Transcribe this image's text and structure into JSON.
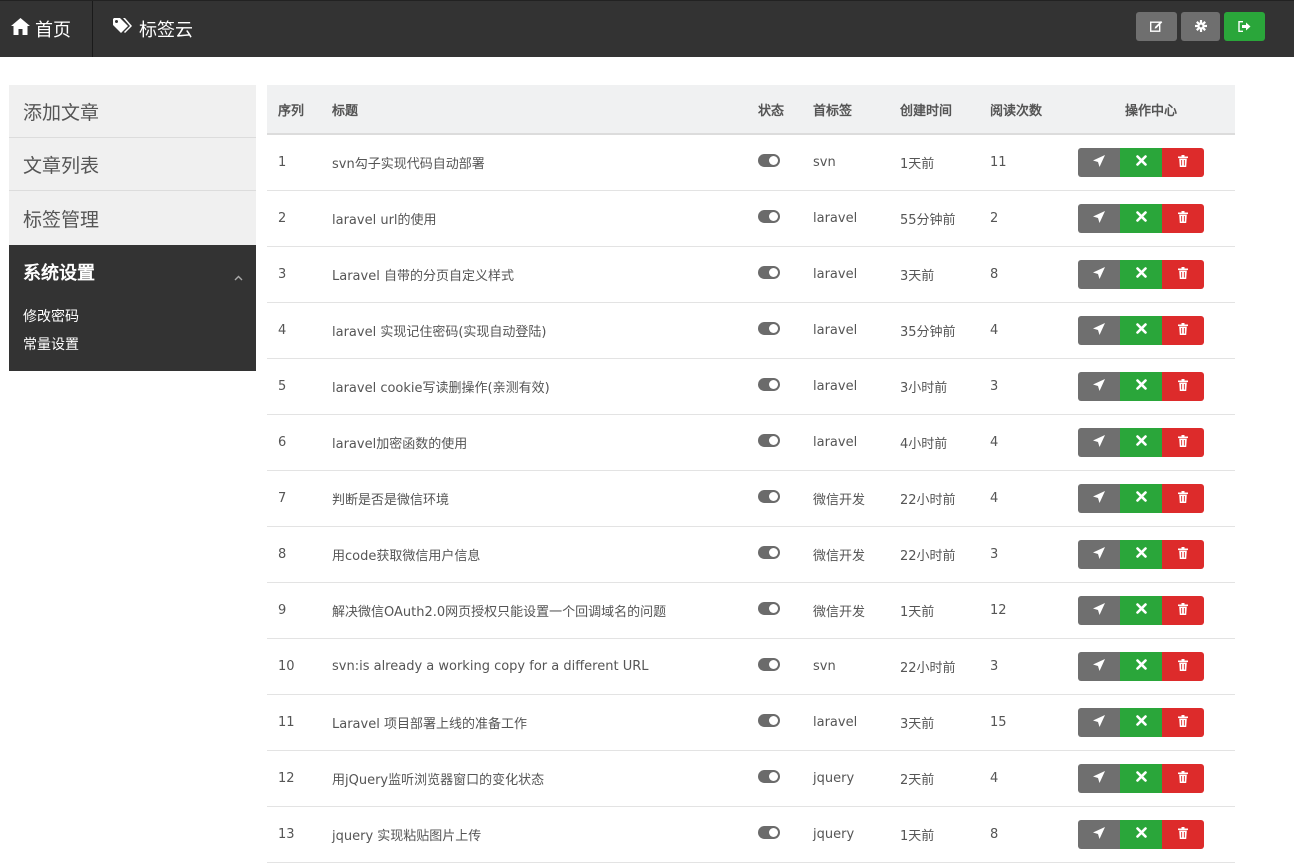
{
  "topbar": {
    "home_label": "首页",
    "tags_label": "标签云",
    "tools": [
      "edit-icon",
      "gear-icon",
      "sign-out-icon"
    ]
  },
  "sidebar": {
    "items": [
      {
        "label": "添加文章"
      },
      {
        "label": "文章列表"
      },
      {
        "label": "标签管理"
      }
    ],
    "group": {
      "label": "系统设置",
      "subitems": [
        {
          "label": "修改密码"
        },
        {
          "label": "常量设置"
        }
      ]
    }
  },
  "table": {
    "headers": {
      "idx": "序列",
      "title": "标题",
      "status": "状态",
      "tag": "首标签",
      "time": "创建时间",
      "views": "阅读次数",
      "ops": "操作中心"
    },
    "rows": [
      {
        "idx": "1",
        "title": "svn勾子实现代码自动部署",
        "tag": "svn",
        "time": "1天前",
        "views": "11"
      },
      {
        "idx": "2",
        "title": "laravel url的使用",
        "tag": "laravel",
        "time": "55分钟前",
        "views": "2"
      },
      {
        "idx": "3",
        "title": "Laravel 自带的分页自定义样式",
        "tag": "laravel",
        "time": "3天前",
        "views": "8"
      },
      {
        "idx": "4",
        "title": "laravel 实现记住密码(实现自动登陆)",
        "tag": "laravel",
        "time": "35分钟前",
        "views": "4"
      },
      {
        "idx": "5",
        "title": "laravel cookie写读删操作(亲测有效)",
        "tag": "laravel",
        "time": "3小时前",
        "views": "3"
      },
      {
        "idx": "6",
        "title": "laravel加密函数的使用",
        "tag": "laravel",
        "time": "4小时前",
        "views": "4"
      },
      {
        "idx": "7",
        "title": "判断是否是微信环境",
        "tag": "微信开发",
        "time": "22小时前",
        "views": "4"
      },
      {
        "idx": "8",
        "title": "用code获取微信用户信息",
        "tag": "微信开发",
        "time": "22小时前",
        "views": "3"
      },
      {
        "idx": "9",
        "title": "解决微信OAuth2.0网页授权只能设置一个回调域名的问题",
        "tag": "微信开发",
        "time": "1天前",
        "views": "12"
      },
      {
        "idx": "10",
        "title": "svn:is already a working copy for a different URL",
        "tag": "svn",
        "time": "22小时前",
        "views": "3"
      },
      {
        "idx": "11",
        "title": "Laravel 项目部署上线的准备工作",
        "tag": "laravel",
        "time": "3天前",
        "views": "15"
      },
      {
        "idx": "12",
        "title": "用jQuery监听浏览器窗口的变化状态",
        "tag": "jquery",
        "time": "2天前",
        "views": "4"
      },
      {
        "idx": "13",
        "title": "jquery 实现粘贴图片上传",
        "tag": "jquery",
        "time": "1天前",
        "views": "8"
      }
    ]
  },
  "colors": {
    "topbar_bg": "#333333",
    "sidebar_bg": "#f0f0f0",
    "button_gray": "#6f6f6f",
    "button_green": "#2aa63a",
    "button_red": "#dd2b2b"
  }
}
